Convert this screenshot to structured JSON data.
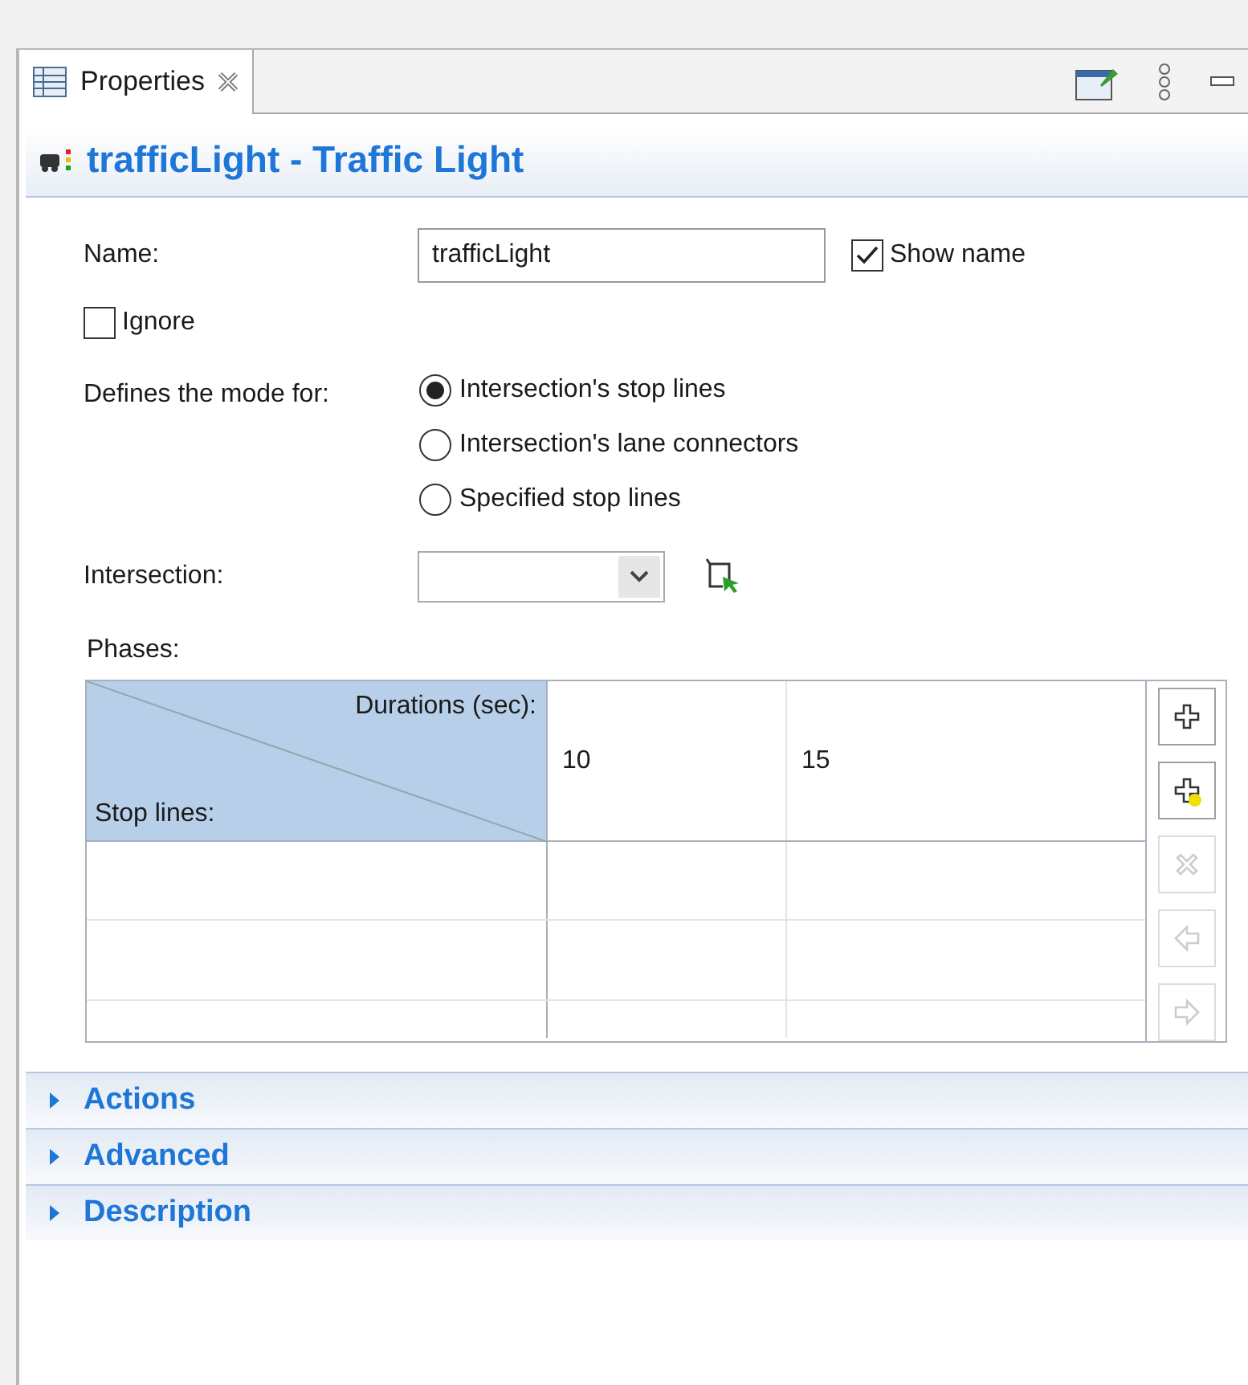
{
  "tab": {
    "label": "Properties"
  },
  "header": {
    "title": "trafficLight - Traffic Light"
  },
  "name_field": {
    "label": "Name:",
    "value": "trafficLight"
  },
  "show_name": {
    "label": "Show name",
    "checked": true
  },
  "ignore": {
    "label": "Ignore",
    "checked": false
  },
  "mode": {
    "label": "Defines the mode for:",
    "options": [
      {
        "label": "Intersection's stop lines",
        "selected": true
      },
      {
        "label": "Intersection's lane connectors",
        "selected": false
      },
      {
        "label": "Specified stop lines",
        "selected": false
      }
    ]
  },
  "intersection": {
    "label": "Intersection:"
  },
  "phases": {
    "label": "Phases:",
    "corner_top": "Durations (sec):",
    "corner_bottom": "Stop lines:",
    "durations": [
      "10",
      "15"
    ],
    "buttons": [
      {
        "kind": "add",
        "disabled": false
      },
      {
        "kind": "add-new",
        "disabled": false
      },
      {
        "kind": "remove",
        "disabled": true
      },
      {
        "kind": "left",
        "disabled": true
      },
      {
        "kind": "right",
        "disabled": true
      }
    ]
  },
  "sections": [
    {
      "label": "Actions",
      "expanded": false
    },
    {
      "label": "Advanced",
      "expanded": false
    },
    {
      "label": "Description",
      "expanded": false
    }
  ]
}
